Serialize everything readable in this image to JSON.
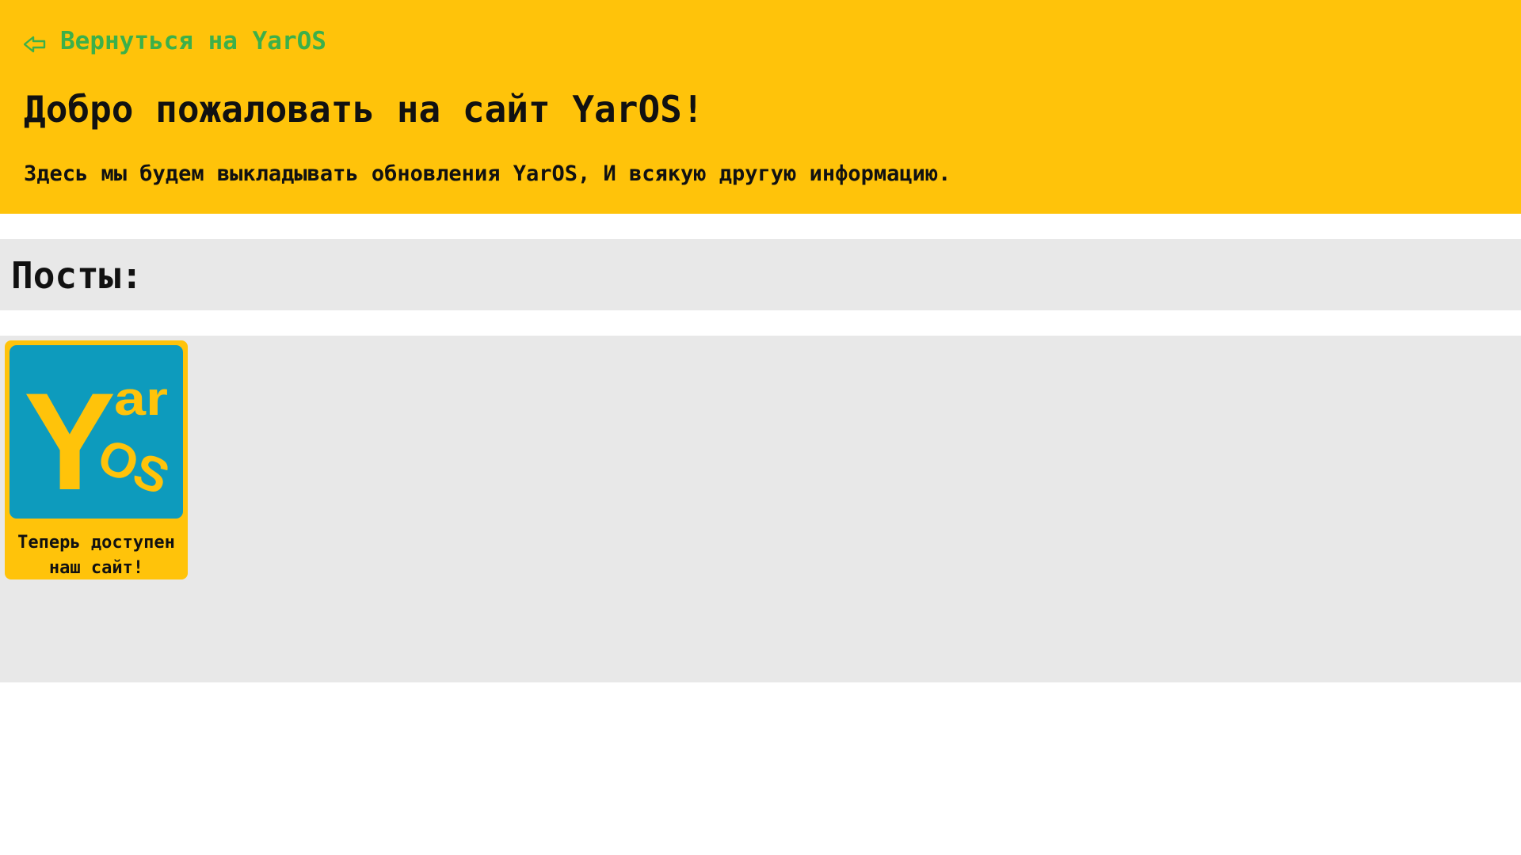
{
  "header": {
    "back_link": {
      "icon": "left-arrow-icon",
      "label": "Вернуться на YarOS"
    },
    "title": "Добро пожаловать на сайт YarOS!",
    "subtitle": "Здесь мы будем выкладывать обновления YarOS, И всякую другую информацию."
  },
  "posts": {
    "heading": "Посты:",
    "items": [
      {
        "image": {
          "logo_text": "YarOS",
          "letters": [
            "Y",
            "ar",
            "OS"
          ]
        },
        "caption": "Теперь доступен наш сайт!"
      }
    ]
  },
  "colors": {
    "accent_yellow": "#ffc30a",
    "link_green": "#3cb04a",
    "panel_gray": "#e8e8e8",
    "logo_blue": "#0d9bbd",
    "text": "#111111"
  }
}
